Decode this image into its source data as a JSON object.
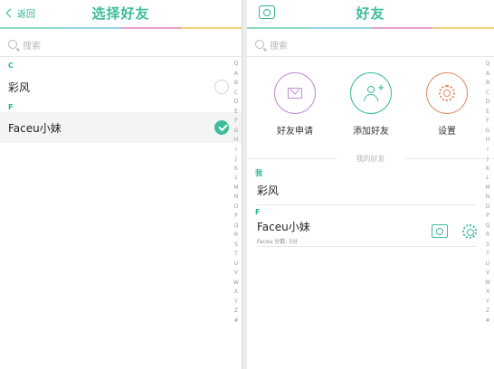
{
  "colors": {
    "accent": "#3dbd9b",
    "accent_bar": [
      "#8cd9c3",
      "#9bd3ea",
      "#e8a0c9",
      "#f2d279"
    ]
  },
  "left": {
    "back_label": "返回",
    "title": "选择好友",
    "search_placeholder": "搜索",
    "sections": [
      {
        "letter": "C",
        "items": [
          {
            "name": "彩风",
            "selected": false
          }
        ]
      },
      {
        "letter": "F",
        "items": [
          {
            "name": "Faceu小妹",
            "selected": true
          }
        ]
      }
    ],
    "alphabet": [
      "Q",
      "A",
      "B",
      "C",
      "D",
      "E",
      "F",
      "G",
      "H",
      "I",
      "J",
      "K",
      "L",
      "M",
      "N",
      "O",
      "P",
      "Q",
      "R",
      "S",
      "T",
      "U",
      "V",
      "W",
      "X",
      "Y",
      "Z",
      "#"
    ]
  },
  "right": {
    "title": "好友",
    "camera_icon": "camera-icon",
    "search_placeholder": "搜索",
    "actions": [
      {
        "label": "好友申请",
        "icon": "mail-icon",
        "color": "#c08ad6"
      },
      {
        "label": "添加好友",
        "icon": "add-user-icon",
        "color": "#3dbd9b"
      },
      {
        "label": "设置",
        "icon": "gear-icon",
        "color": "#e28b62"
      }
    ],
    "friends_header": "我的好友",
    "sections": [
      {
        "letter": "我",
        "items": [
          {
            "name": "彩风",
            "sub": ""
          }
        ]
      },
      {
        "letter": "F",
        "items": [
          {
            "name": "Faceu小妹",
            "sub": "Faceu  分数: 5分"
          }
        ]
      }
    ],
    "alphabet": [
      "Q",
      "A",
      "B",
      "C",
      "D",
      "E",
      "F",
      "G",
      "H",
      "I",
      "J",
      "K",
      "L",
      "M",
      "N",
      "O",
      "P",
      "Q",
      "R",
      "S",
      "T",
      "U",
      "V",
      "W",
      "X",
      "Y",
      "Z",
      "#"
    ]
  }
}
